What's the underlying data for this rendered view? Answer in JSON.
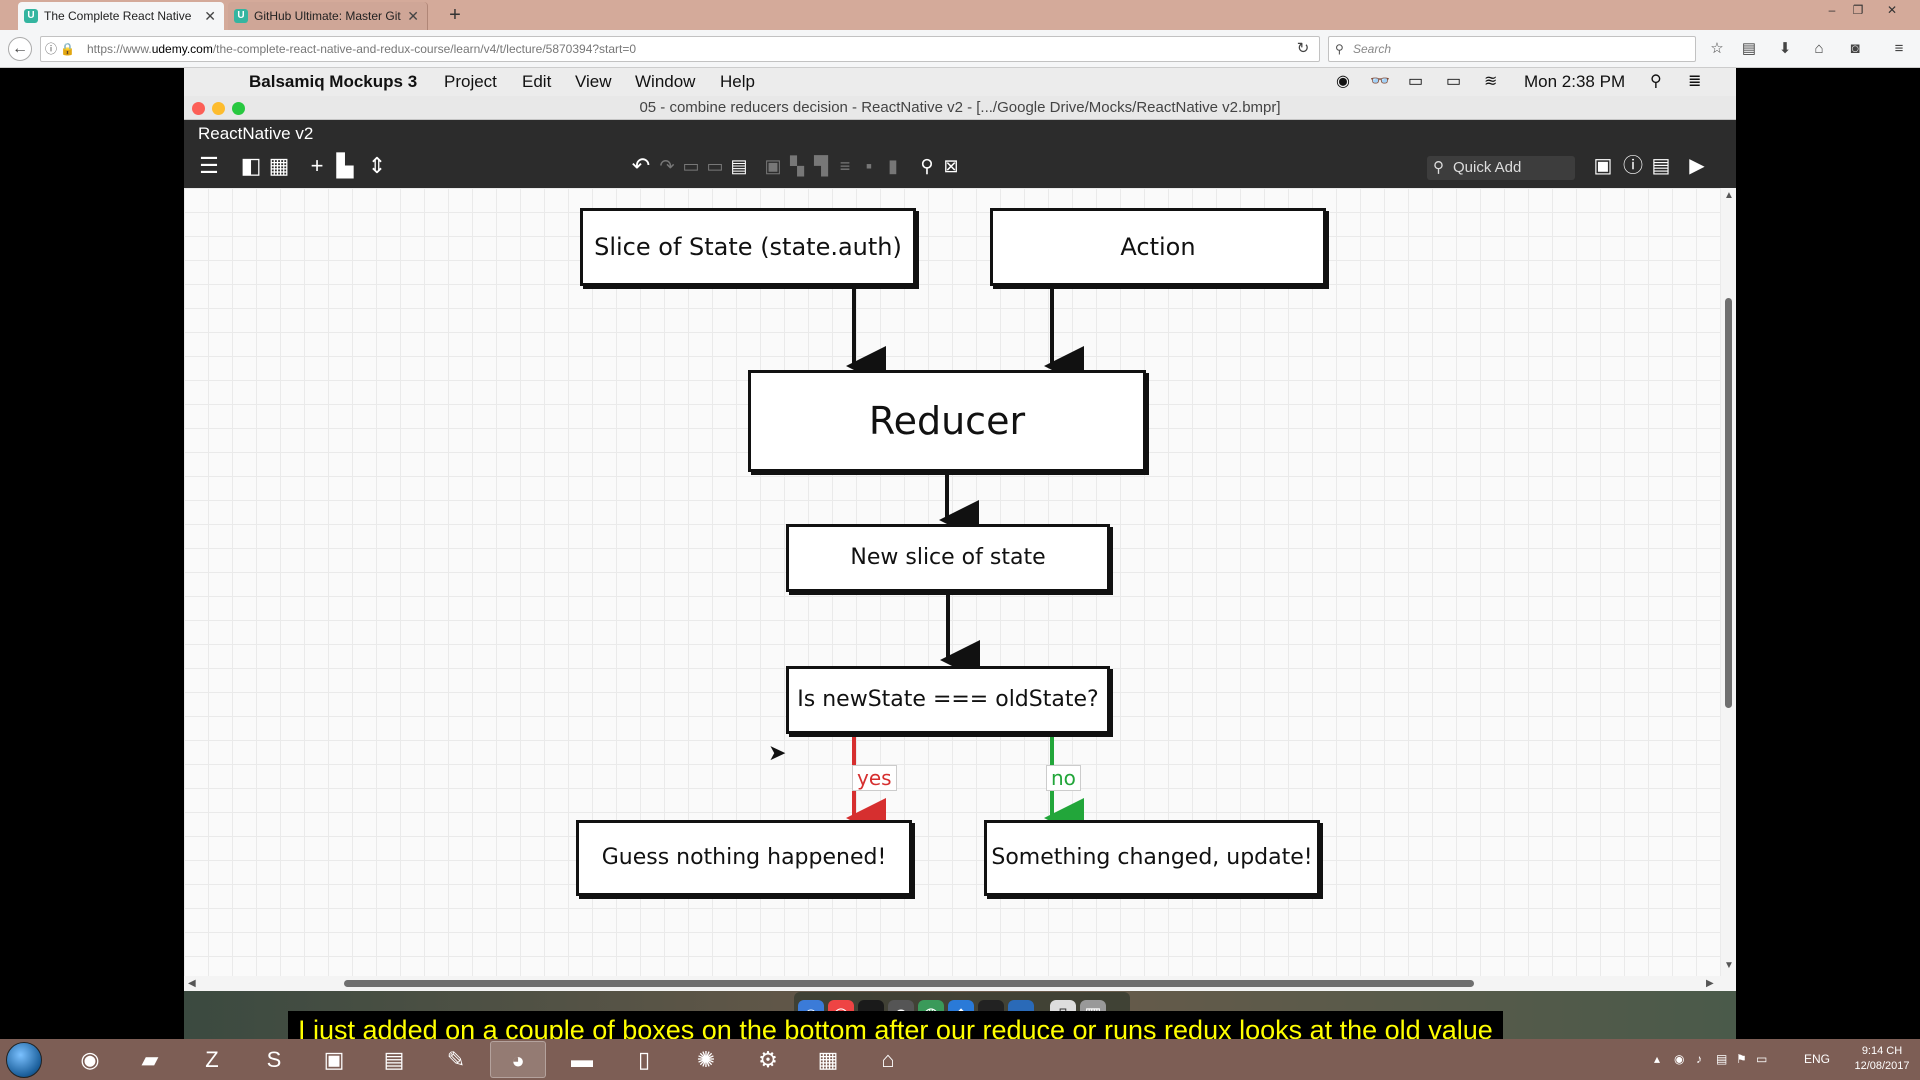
{
  "browser": {
    "tabs": [
      {
        "favicon": "U",
        "title": "The Complete React Native"
      },
      {
        "favicon": "U",
        "title": "GitHub Ultimate: Master Git"
      }
    ],
    "url_prefix": "https://www.",
    "url_domain": "udemy.com",
    "url_path": "/the-complete-react-native-and-redux-course/learn/v4/t/lecture/5870394?start=0",
    "search_placeholder": "Search"
  },
  "mac": {
    "menu": {
      "app": "Balsamiq Mockups 3",
      "items": [
        "Project",
        "Edit",
        "View",
        "Window",
        "Help"
      ],
      "clock": "Mon 2:38 PM"
    },
    "window_title": "05 - combine reducers decision - ReactNative v2 - [.../Google Drive/Mocks/ReactNative v2.bmpr]",
    "project_title": "ReactNative v2",
    "quick_add": "Quick Add"
  },
  "diagram": {
    "nodes": {
      "slice": "Slice of State (state.auth)",
      "action": "Action",
      "reducer": "Reducer",
      "new_slice": "New slice of state",
      "decision": "Is newState === oldState?",
      "nothing": "Guess nothing happened!",
      "changed": "Something changed, update!"
    },
    "edges": {
      "yes": "yes",
      "no": "no"
    },
    "colors": {
      "yes": "#d62f2f",
      "no": "#22a63a",
      "line": "#111111"
    }
  },
  "subtitle": "I just added on a couple of boxes on the bottom after our reduce or runs redux looks at the old value",
  "taskbar": {
    "language": "ENG",
    "time": "9:14 CH",
    "date": "12/08/2017"
  }
}
